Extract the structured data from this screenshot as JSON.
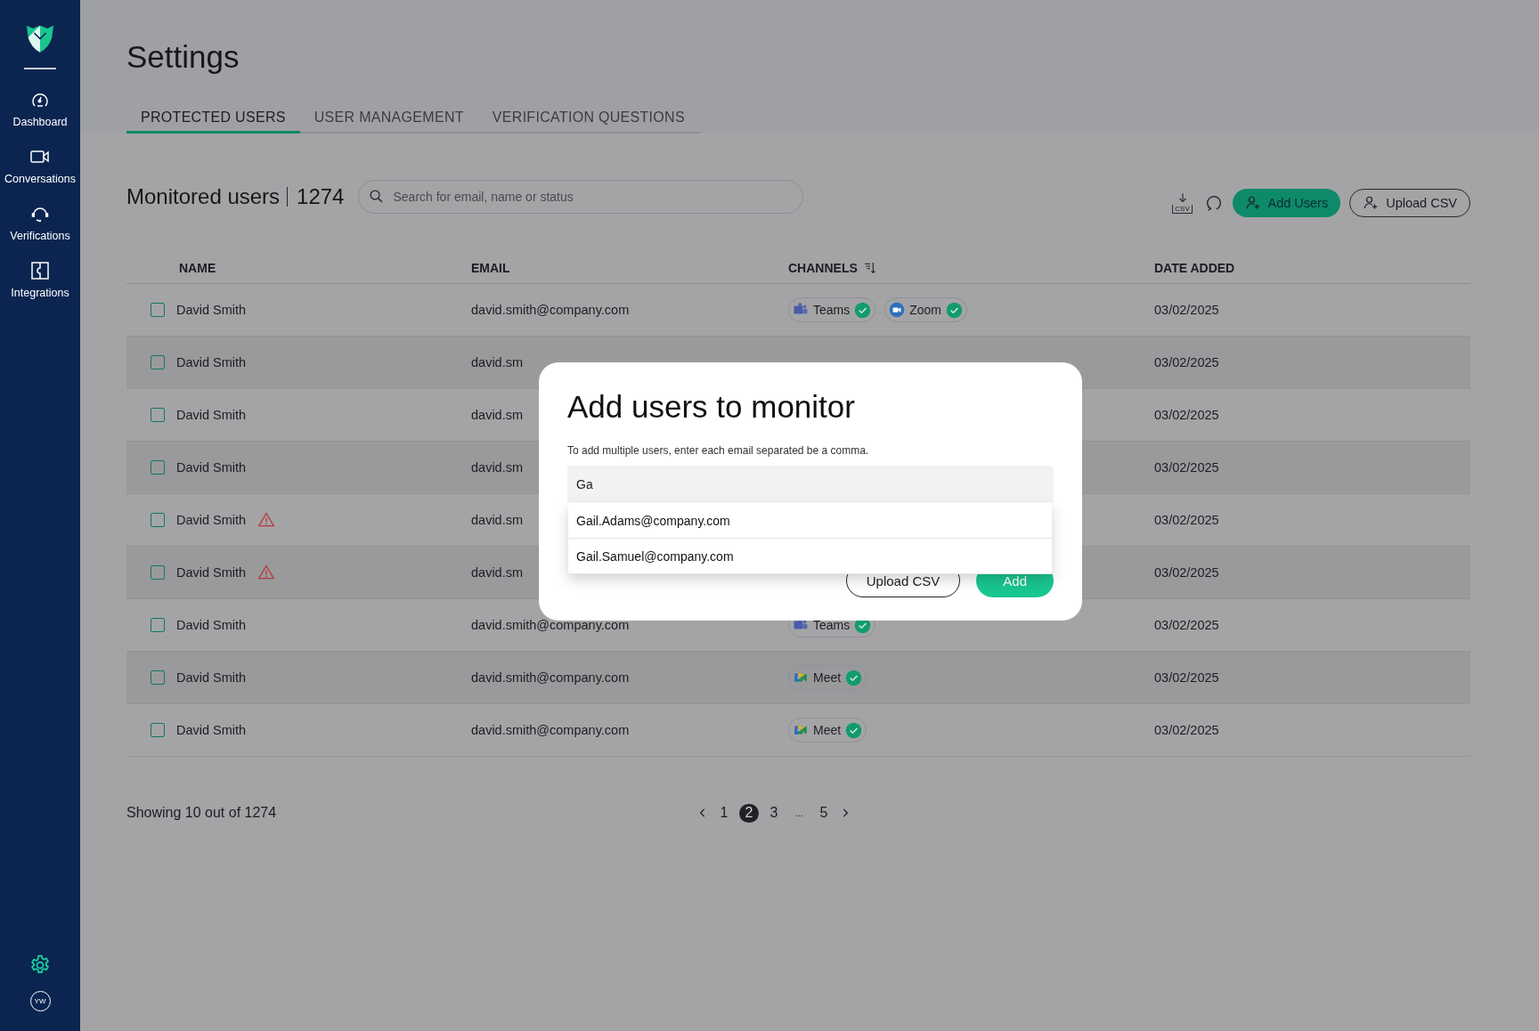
{
  "sidebar": {
    "items": [
      {
        "label": "Dashboard"
      },
      {
        "label": "Conversations"
      },
      {
        "label": "Verifications"
      },
      {
        "label": "Integrations"
      }
    ],
    "settings": {
      "selected": true
    },
    "avatar": {
      "initials": "YW"
    }
  },
  "page_title": "Settings",
  "tabs": [
    {
      "label": "PROTECTED USERS",
      "selected": true
    },
    {
      "label": "USER MANAGEMENT",
      "selected": false
    },
    {
      "label": "VERIFICATION QUESTIONS",
      "selected": false
    }
  ],
  "section": {
    "title": "Monitored users",
    "count": "1274"
  },
  "search": {
    "placeholder": "Search for email, name or status"
  },
  "toolbar": {
    "download_label": "CSV",
    "buttons": [
      {
        "label": "Add Users",
        "kind": "primary"
      },
      {
        "label": "Upload CSV",
        "kind": "outline"
      }
    ]
  },
  "table": {
    "columns": [
      {
        "label": "NAME",
        "sortable": false
      },
      {
        "label": "EMAIL",
        "sortable": false
      },
      {
        "label": "CHANNELS",
        "sortable": true
      },
      {
        "label": "DATE ADDED",
        "sortable": false
      }
    ],
    "rows": [
      {
        "checked": false,
        "name": "David Smith",
        "warning": false,
        "email": "david.smith@company.com",
        "channels": [
          {
            "name": "Teams",
            "kind": "teams",
            "verified": true
          },
          {
            "name": "Zoom",
            "kind": "zoom",
            "verified": true
          }
        ],
        "date": "03/02/2025"
      },
      {
        "checked": false,
        "name": "David Smith",
        "warning": false,
        "email": "david.sm",
        "channels": [],
        "date": "03/02/2025"
      },
      {
        "checked": false,
        "name": "David Smith",
        "warning": false,
        "email": "david.sm",
        "channels": [],
        "date": "03/02/2025"
      },
      {
        "checked": false,
        "name": "David Smith",
        "warning": false,
        "email": "david.sm",
        "channels": [],
        "date": "03/02/2025"
      },
      {
        "checked": false,
        "name": "David Smith",
        "warning": true,
        "email": "david.sm",
        "channels": [],
        "date": "03/02/2025"
      },
      {
        "checked": false,
        "name": "David Smith",
        "warning": true,
        "email": "david.sm",
        "channels": [],
        "date": "03/02/2025"
      },
      {
        "checked": false,
        "name": "David Smith",
        "warning": false,
        "email": "david.smith@company.com",
        "channels": [
          {
            "name": "Teams",
            "kind": "teams",
            "verified": true
          }
        ],
        "date": "03/02/2025"
      },
      {
        "checked": false,
        "name": "David Smith",
        "warning": false,
        "email": "david.smith@company.com",
        "channels": [
          {
            "name": "Meet",
            "kind": "meet",
            "verified": true
          }
        ],
        "date": "03/02/2025"
      },
      {
        "checked": false,
        "name": "David Smith",
        "warning": false,
        "email": "david.smith@company.com",
        "channels": [
          {
            "name": "Meet",
            "kind": "meet",
            "verified": true
          }
        ],
        "date": "03/02/2025"
      }
    ]
  },
  "pagination": {
    "summary": "Showing 10 out of 1274",
    "pages": [
      {
        "label": "1",
        "selected": false
      },
      {
        "label": "2",
        "selected": true
      },
      {
        "label": "3",
        "selected": false
      },
      {
        "label": "...",
        "selected": false
      },
      {
        "label": "5",
        "selected": false
      }
    ]
  },
  "modal": {
    "title": "Add users to monitor",
    "hint": "To add multiple users, enter each email separated be a comma.",
    "input_value": "Ga",
    "suggestions": [
      "Gail.Adams@company.com",
      "Gail.Samuel@company.com"
    ],
    "buttons": [
      {
        "label": "Upload CSV",
        "kind": "outline"
      },
      {
        "label": "Add",
        "kind": "primary"
      }
    ]
  }
}
